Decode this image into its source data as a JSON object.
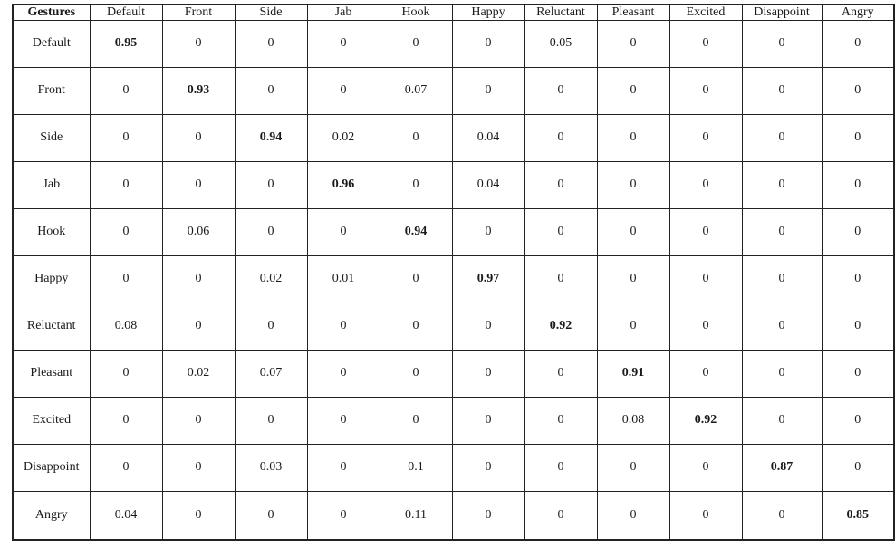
{
  "table": {
    "corner_label": "Gestures",
    "columns": [
      "Default",
      "Front",
      "Side",
      "Jab",
      "Hook",
      "Happy",
      "Reluctant",
      "Pleasant",
      "Excited",
      "Disappoint",
      "Angry"
    ],
    "rows": [
      {
        "label": "Default",
        "values": [
          "0.95",
          "0",
          "0",
          "0",
          "0",
          "0",
          "0.05",
          "0",
          "0",
          "0",
          "0"
        ]
      },
      {
        "label": "Front",
        "values": [
          "0",
          "0.93",
          "0",
          "0",
          "0.07",
          "0",
          "0",
          "0",
          "0",
          "0",
          "0"
        ]
      },
      {
        "label": "Side",
        "values": [
          "0",
          "0",
          "0.94",
          "0.02",
          "0",
          "0.04",
          "0",
          "0",
          "0",
          "0",
          "0"
        ]
      },
      {
        "label": "Jab",
        "values": [
          "0",
          "0",
          "0",
          "0.96",
          "0",
          "0.04",
          "0",
          "0",
          "0",
          "0",
          "0"
        ]
      },
      {
        "label": "Hook",
        "values": [
          "0",
          "0.06",
          "0",
          "0",
          "0.94",
          "0",
          "0",
          "0",
          "0",
          "0",
          "0"
        ]
      },
      {
        "label": "Happy",
        "values": [
          "0",
          "0",
          "0.02",
          "0.01",
          "0",
          "0.97",
          "0",
          "0",
          "0",
          "0",
          "0"
        ]
      },
      {
        "label": "Reluctant",
        "values": [
          "0.08",
          "0",
          "0",
          "0",
          "0",
          "0",
          "0.92",
          "0",
          "0",
          "0",
          "0"
        ]
      },
      {
        "label": "Pleasant",
        "values": [
          "0",
          "0.02",
          "0.07",
          "0",
          "0",
          "0",
          "0",
          "0.91",
          "0",
          "0",
          "0"
        ]
      },
      {
        "label": "Excited",
        "values": [
          "0",
          "0",
          "0",
          "0",
          "0",
          "0",
          "0",
          "0.08",
          "0.92",
          "0",
          "0"
        ]
      },
      {
        "label": "Disappoint",
        "values": [
          "0",
          "0",
          "0.03",
          "0",
          "0.1",
          "0",
          "0",
          "0",
          "0",
          "0.87",
          "0"
        ]
      },
      {
        "label": "Angry",
        "values": [
          "0.04",
          "0",
          "0",
          "0",
          "0.11",
          "0",
          "0",
          "0",
          "0",
          "0",
          "0.85"
        ]
      }
    ]
  }
}
